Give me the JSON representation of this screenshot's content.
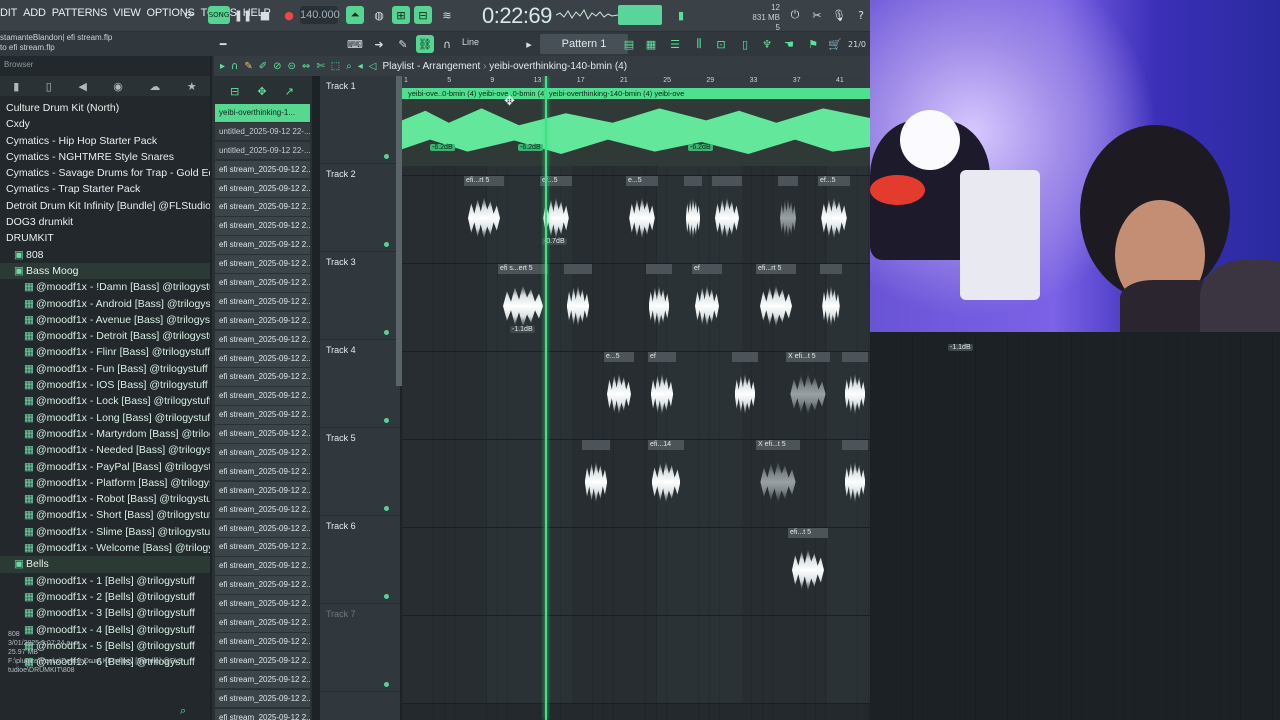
{
  "menu": [
    "DIT",
    "ADD",
    "PATTERNS",
    "VIEW",
    "OPTIONS",
    "TOOLS",
    "HELP"
  ],
  "transport": {
    "tempo": "140.000",
    "time": "0:22:69",
    "cpu_top": "12",
    "mem": "831 MB",
    "cpu_bottom": "5"
  },
  "project": {
    "line1": "stamanteBlandon| efi stream.flp",
    "line2": "to efi stream.flp"
  },
  "toolbar": {
    "snap": "Line",
    "pattern": "Pattern 1",
    "zoom": "21/0"
  },
  "browser": {
    "title": "Browser",
    "items": [
      {
        "label": "Culture Drum Kit (North)",
        "level": 1
      },
      {
        "label": "Cxdy",
        "level": 1
      },
      {
        "label": "Cymatics - Hip Hop Starter Pack",
        "level": 1
      },
      {
        "label": "Cymatics - NGHTMRE Style Snares",
        "level": 1
      },
      {
        "label": "Cymatics - Savage Drums for Trap - Gold Edition",
        "level": 1
      },
      {
        "label": "Cymatics - Trap Starter Pack",
        "level": 1
      },
      {
        "label": "Detroit Drum Kit Infinity [Bundle] @FLStudioe",
        "level": 1
      },
      {
        "label": "DOG3 drumkit",
        "level": 1
      },
      {
        "label": "DRUMKIT",
        "level": 1
      },
      {
        "label": "808",
        "level": 2
      },
      {
        "label": "Bass Moog",
        "level": 2
      },
      {
        "label": "@moodf1x - !Damn [Bass] @trilogystuff",
        "level": 3
      },
      {
        "label": "@moodf1x - Android [Bass] @trilogystuff",
        "level": 3
      },
      {
        "label": "@moodf1x - Avenue [Bass] @trilogystuff",
        "level": 3
      },
      {
        "label": "@moodf1x - Detroit [Bass] @trilogystuff",
        "level": 3
      },
      {
        "label": "@moodf1x - Flinr [Bass] @trilogystuff",
        "level": 3
      },
      {
        "label": "@moodf1x - Fun [Bass] @trilogystuff",
        "level": 3
      },
      {
        "label": "@moodf1x - IOS [Bass] @trilogystuff",
        "level": 3
      },
      {
        "label": "@moodf1x - Lock [Bass] @trilogystuff",
        "level": 3
      },
      {
        "label": "@moodf1x - Long [Bass] @trilogystuff",
        "level": 3
      },
      {
        "label": "@moodf1x - Martyrdom [Bass] @trilogystuff",
        "level": 3
      },
      {
        "label": "@moodf1x - Needed [Bass] @trilogystuff",
        "level": 3
      },
      {
        "label": "@moodf1x - PayPal [Bass] @trilogystuff",
        "level": 3
      },
      {
        "label": "@moodf1x - Platform [Bass] @trilogystuff",
        "level": 3
      },
      {
        "label": "@moodf1x - Robot [Bass] @trilogystuff",
        "level": 3
      },
      {
        "label": "@moodf1x - Short [Bass] @trilogystuff",
        "level": 3
      },
      {
        "label": "@moodf1x - Slime [Bass] @trilogystuff",
        "level": 3
      },
      {
        "label": "@moodf1x - Welcome [Bass] @trilogystuff",
        "level": 3
      },
      {
        "label": "Bells",
        "level": 2
      },
      {
        "label": "@moodf1x - 1 [Bells] @trilogystuff",
        "level": 3
      },
      {
        "label": "@moodf1x - 2 [Bells] @trilogystuff",
        "level": 3
      },
      {
        "label": "@moodf1x - 3 [Bells] @trilogystuff",
        "level": 3
      },
      {
        "label": "@moodf1x - 4 [Bells] @trilogystuff",
        "level": 3
      },
      {
        "label": "@moodf1x - 5 [Bells] @trilogystuff",
        "level": 3
      },
      {
        "label": "@moodf1x - 6 [Bells] @trilogystuff",
        "level": 3
      }
    ],
    "info": {
      "name": "808",
      "date": "3/01/2025 3:07:24 a. m.",
      "size": "25.97 MB",
      "path": "F:\\plugins\\Packs\\Detroit Drum Kit Infinity [Bundle] @FLS-tudioe\\DRUMKIT\\808"
    }
  },
  "picker": {
    "clips": [
      "yeibi-overthinking-1...",
      "untitled_2025-09-12 22-...",
      "untitled_2025-09-12 22-...",
      "efi stream_2025-09-12 2...",
      "efi stream_2025-09-12 2...",
      "efi stream_2025-09-12 2...",
      "efi stream_2025-09-12 2...",
      "efi stream_2025-09-12 2...",
      "efi stream_2025-09-12 2...",
      "efi stream_2025-09-12 2...",
      "efi stream_2025-09-12 2...",
      "efi stream_2025-09-12 2...",
      "efi stream_2025-09-12 2...",
      "efi stream_2025-09-12 2...",
      "efi stream_2025-09-12 2...",
      "efi stream_2025-09-12 2...",
      "efi stream_2025-09-12 2...",
      "efi stream_2025-09-12 2...",
      "efi stream_2025-09-12 2...",
      "efi stream_2025-09-12 2...",
      "efi stream_2025-09-12 2...",
      "efi stream_2025-09-12 2...",
      "efi stream_2025-09-12 2...",
      "efi stream_2025-09-12 2...",
      "efi stream_2025-09-12 2...",
      "efi stream_2025-09-12 2...",
      "efi stream_2025-09-12 2...",
      "efi stream_2025-09-12 2...",
      "efi stream_2025-09-12 2...",
      "efi stream_2025-09-12 2...",
      "efi stream_2025-09-12 2...",
      "efi stream_2025-09-12 2...",
      "efi stream_2025-09-12 2...",
      "efi stream_2025-09-12 2..."
    ]
  },
  "playlist": {
    "title": "Playlist - Arrangement",
    "pattern": "yeibi-overthinking-140-bmin (4)",
    "ruler": [
      "1",
      "5",
      "9",
      "13",
      "17",
      "21",
      "25",
      "29",
      "33",
      "37",
      "41"
    ],
    "tracks": [
      "Track 1",
      "Track 2",
      "Track 3",
      "Track 4",
      "Track 5",
      "Track 6",
      "Track 7"
    ],
    "track1_label": "yeibi-ove..0-bmin (4)  yeibi-ove..0-bmin (4)  yeibi-overthinking-140-bmin (4)                                   yeibi-ove",
    "track1_gains": [
      "-6.2dB",
      "-6.2dB",
      "-6.2dB"
    ],
    "region_labels": {
      "t2": [
        "efi...rt 5",
        "ef...5",
        "e...5",
        "",
        "",
        "",
        "ef...5"
      ],
      "t3": [
        "efi s...ert 5",
        "",
        "",
        "ef",
        "efi...rt 5",
        ""
      ],
      "t4": [
        "e...5",
        "ef",
        "",
        "X efi...t 5",
        ""
      ],
      "t5": [
        "",
        "efi...14",
        "X efi...t 5",
        ""
      ],
      "t6": [
        "efi...t 5"
      ]
    },
    "region_gains": {
      "t2": "-0.7dB",
      "t3": "-1.1dB",
      "t3_outer": "-1.1dB"
    }
  }
}
